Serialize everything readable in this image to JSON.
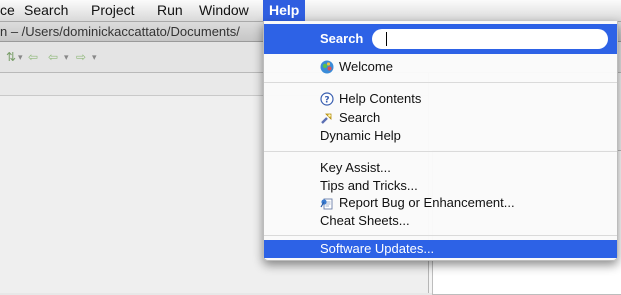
{
  "menubar": {
    "items": [
      "ce",
      "Search",
      "Project",
      "Run",
      "Window",
      "Help"
    ]
  },
  "window": {
    "title": "n – /Users/dominickaccattato/Documents/"
  },
  "help_menu": {
    "search_label": "Search",
    "search_value": "",
    "items": {
      "welcome": "Welcome",
      "help_contents": "Help Contents",
      "search": "Search",
      "dynamic_help": "Dynamic Help",
      "key_assist": "Key Assist...",
      "tips_tricks": "Tips and Tricks...",
      "report_bug": "Report Bug or Enhancement...",
      "cheat_sheets": "Cheat Sheets...",
      "software_updates": "Software Updates..."
    }
  },
  "colors": {
    "highlight": "#2d62e6"
  }
}
